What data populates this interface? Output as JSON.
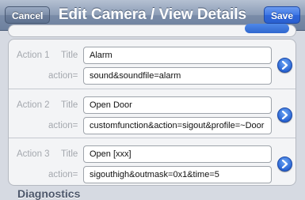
{
  "navbar": {
    "title": "Edit Camera / View Details",
    "cancel_label": "Cancel",
    "save_label": "Save"
  },
  "field_labels": {
    "title": "Title",
    "action": "action="
  },
  "actions": [
    {
      "label": "Action 1",
      "title": "Alarm",
      "action": "sound&soundfile=alarm"
    },
    {
      "label": "Action 2",
      "title": "Open Door",
      "action": "customfunction&action=sigout&profile=~Door"
    },
    {
      "label": "Action 3",
      "title": "Open [xxx]",
      "action": "sigouthigh&outmask=0x1&time=5"
    }
  ],
  "section_header": "Diagnostics",
  "colors": {
    "navbar": "#8d9db6",
    "save_button": "#2e66da",
    "disclosure": "#2b66d4",
    "background": "#d6dae2"
  }
}
